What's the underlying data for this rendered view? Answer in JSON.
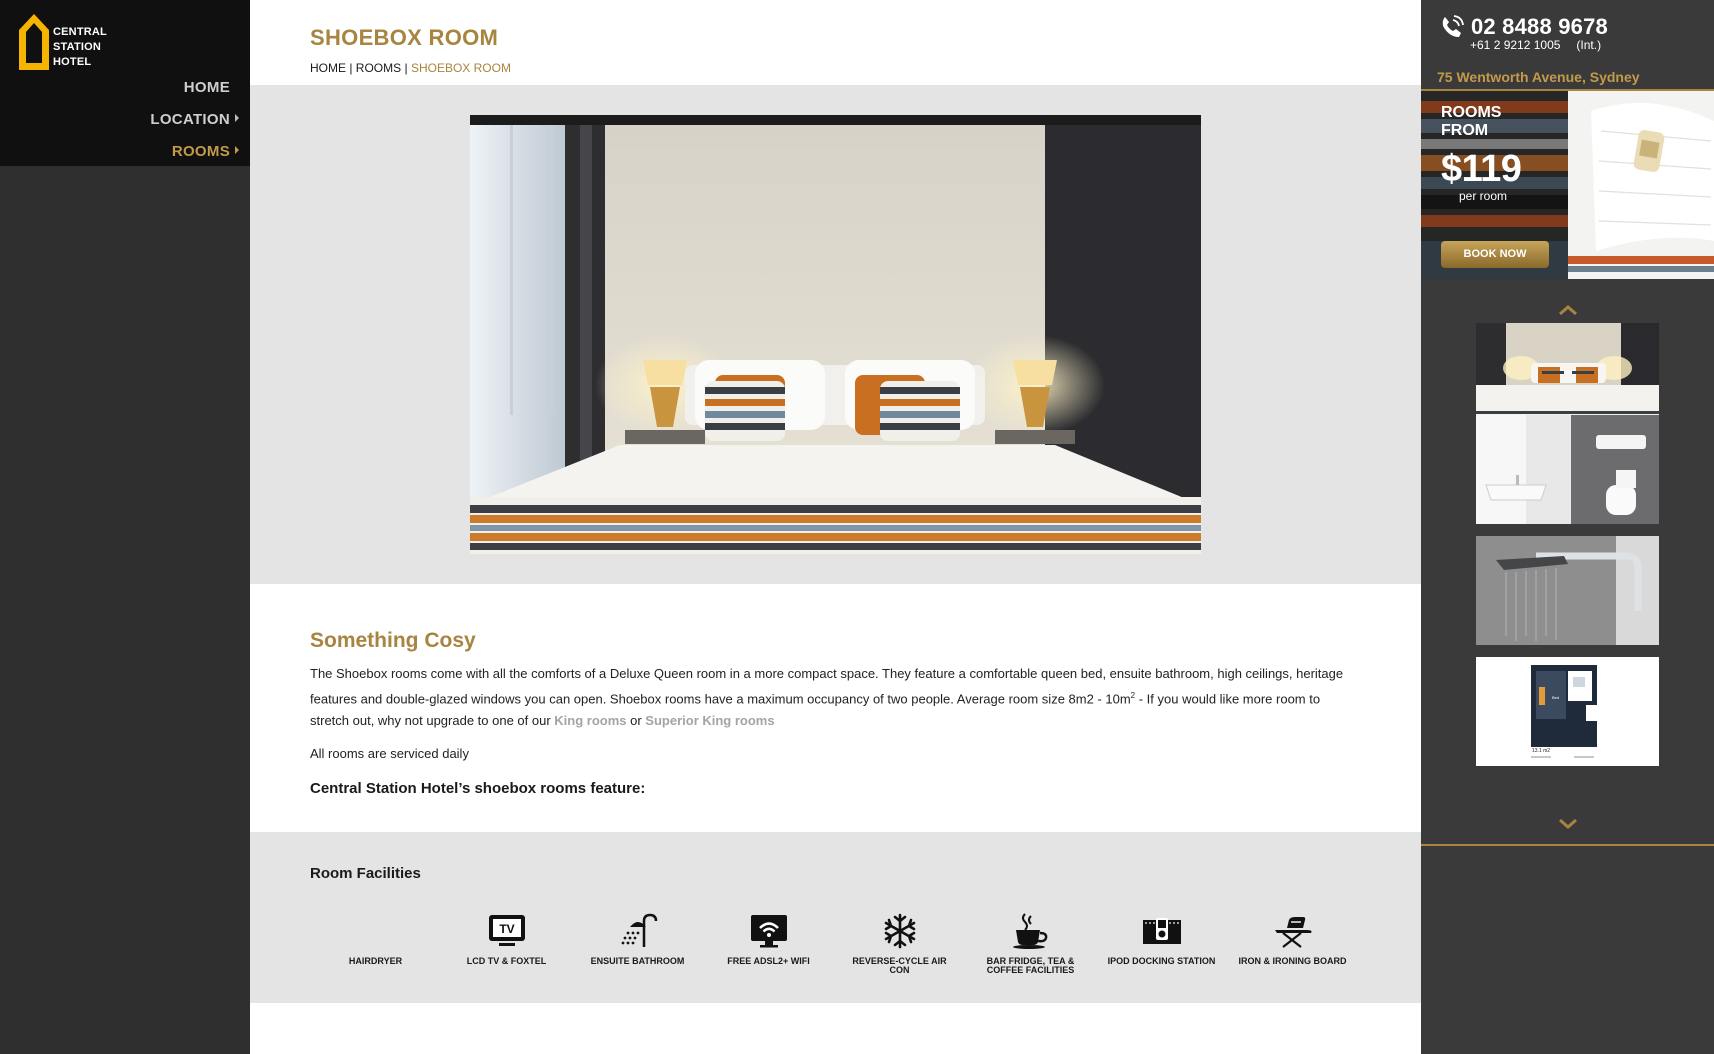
{
  "brand": {
    "logo_text": [
      "CENTRAL",
      "STATION",
      "HOTEL"
    ],
    "accent": "#a88441",
    "logo_yellow": "#f4b400"
  },
  "nav": [
    {
      "label": "HOME",
      "has_arrow": false,
      "active": false
    },
    {
      "label": "LOCATION",
      "has_arrow": true,
      "active": false
    },
    {
      "label": "ROOMS",
      "has_arrow": true,
      "active": true
    }
  ],
  "header": {
    "title": "SHOEBOX ROOM",
    "breadcrumb": {
      "home": "HOME",
      "sep1": " | ",
      "rooms": "ROOMS",
      "sep2": " | ",
      "current": "SHOEBOX ROOM"
    }
  },
  "content": {
    "heading": "Something Cosy",
    "desc_part1": "The Shoebox rooms come with all the comforts of a Deluxe Queen room in a more compact space. They feature a comfortable queen bed, ensuite bathroom, high ceilings, heritage features and double-glazed windows you can open. Shoebox rooms have a maximum occupancy of two people. Average room size 8m2 - 10m",
    "desc_sup": "2",
    "desc_part2": " - If you would like more room to stretch out, why not upgrade to one of our ",
    "link_king": "King rooms",
    "desc_or": " or ",
    "link_superior": "Superior King rooms",
    "serviced": "All rooms are serviced daily",
    "feature_heading": "Central Station Hotel’s shoebox rooms feature:"
  },
  "facilities": {
    "heading": "Room Facilities",
    "items": [
      {
        "label": "HAIRDRYER",
        "icon": "hairdryer-icon"
      },
      {
        "label": "LCD TV & FOXTEL",
        "icon": "tv-icon"
      },
      {
        "label": "ENSUITE BATHROOM",
        "icon": "shower-icon"
      },
      {
        "label": "FREE ADSL2+ WIFI",
        "icon": "wifi-monitor-icon"
      },
      {
        "label": "REVERSE-CYCLE AIR CON",
        "icon": "snowflake-icon"
      },
      {
        "label": "BAR FRIDGE, TEA & COFFEE FACILITIES",
        "icon": "coffee-cup-icon"
      },
      {
        "label": "IPOD DOCKING STATION",
        "icon": "ipod-dock-icon"
      },
      {
        "label": "IRON & IRONING BOARD",
        "icon": "iron-icon"
      }
    ]
  },
  "contact": {
    "phone": "02 8488 9678",
    "intl_phone": "+61 2 9212 1005",
    "intl_label": "(Int.)",
    "address": "75 Wentworth Avenue, Sydney"
  },
  "promo": {
    "rooms_from": "ROOMS FROM",
    "price": "$119",
    "per": "per room",
    "book": "BOOK NOW"
  },
  "gallery": {
    "thumbs": [
      "bedroom-photo",
      "bathroom-photo",
      "shower-photo",
      "floorplan"
    ],
    "floorplan_area": "13.1 m2",
    "floorplan_room_label": "Bed"
  }
}
